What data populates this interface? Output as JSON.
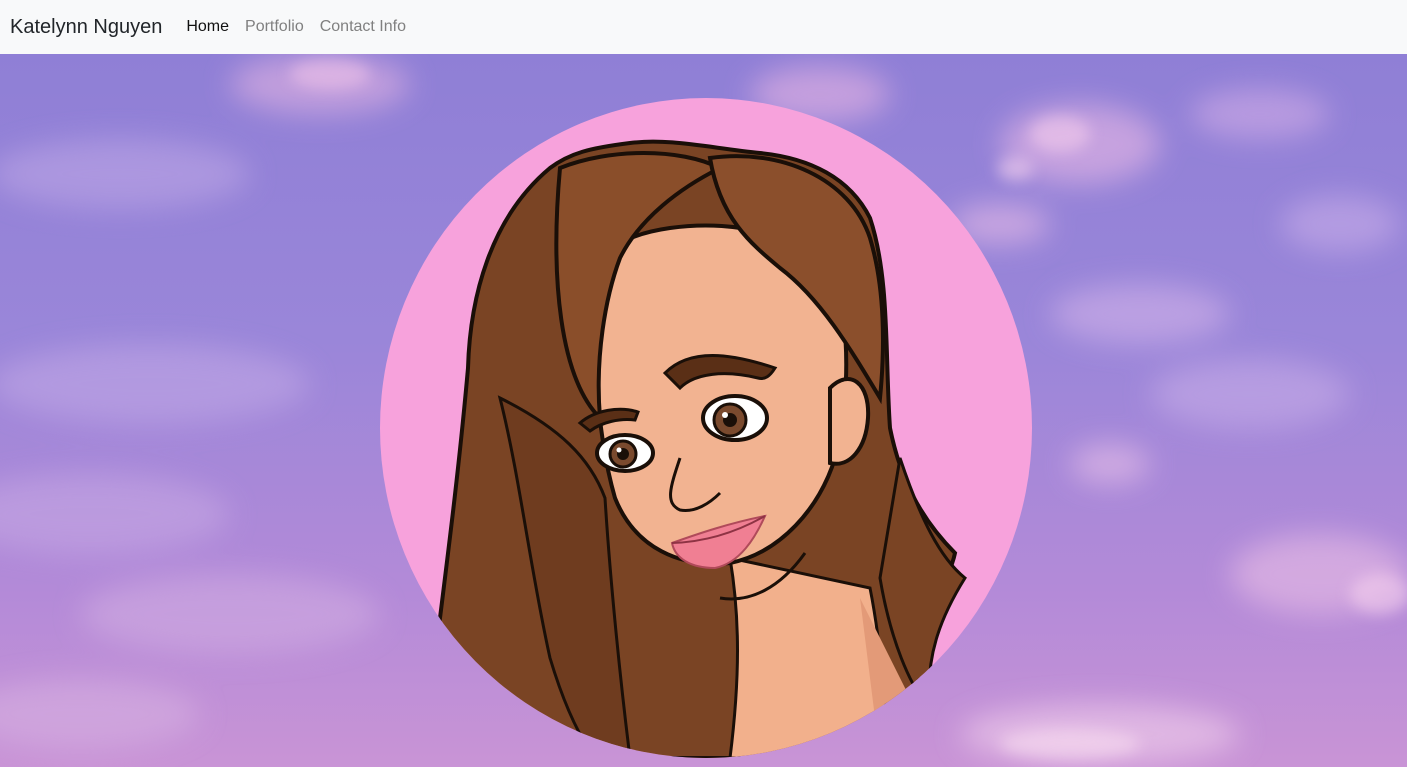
{
  "nav": {
    "brand": "Katelynn Nguyen",
    "links": [
      {
        "label": "Home",
        "active": true
      },
      {
        "label": "Portfolio",
        "active": false
      },
      {
        "label": "Contact Info",
        "active": false
      }
    ]
  },
  "hero": {
    "background": "purple-pink-cloudy-sky",
    "avatar": "illustrated-portrait-avatar",
    "avatar_bg_color": "#f7a2dc"
  }
}
